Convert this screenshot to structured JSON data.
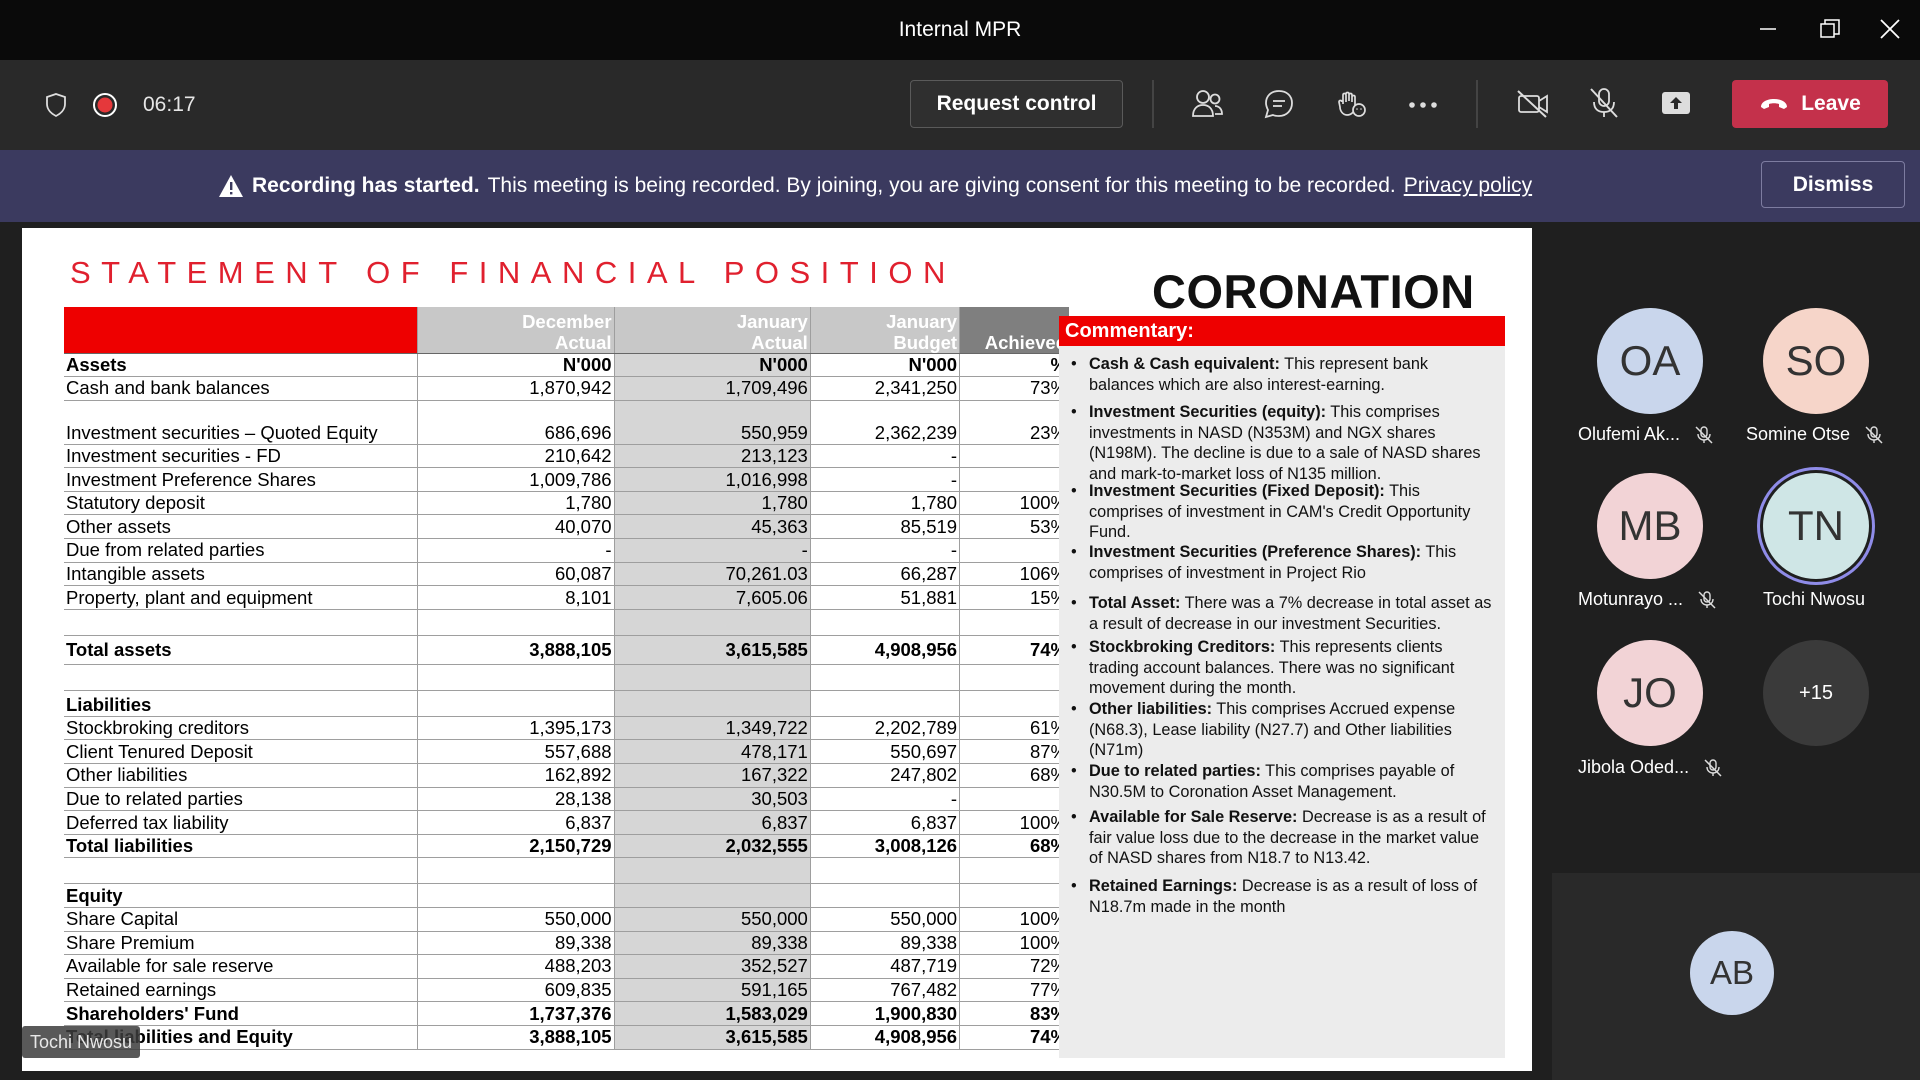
{
  "window": {
    "title": "Internal MPR"
  },
  "toolbar": {
    "timer": "06:17",
    "request_control": "Request control",
    "leave": "Leave"
  },
  "banner": {
    "bold": "Recording has started.",
    "text": "This meeting is being recorded. By joining, you are giving consent for this meeting to be recorded.",
    "link": "Privacy policy",
    "dismiss": "Dismiss"
  },
  "slide": {
    "title": "STATEMENT OF FINANCIAL POSITION",
    "logo": "CORONATION",
    "headers": {
      "c1": [
        "December",
        "Actual"
      ],
      "c2": [
        "January",
        "Actual"
      ],
      "c3": [
        "January",
        "Budget"
      ],
      "c4": "Achieved"
    },
    "rows": [
      {
        "label": "Assets",
        "v": [
          "N'000",
          "N'000",
          "N'000",
          "%"
        ],
        "style": "bold"
      },
      {
        "label": "Cash and bank balances",
        "v": [
          "1,870,942",
          "1,709,496",
          "2,341,250",
          "73%"
        ]
      },
      {
        "label": "Investment securities – Quoted Equity",
        "v": [
          "686,696",
          "550,959",
          "2,362,239",
          "23%"
        ],
        "style": "tall"
      },
      {
        "label": "Investment securities - FD",
        "v": [
          "210,642",
          "213,123",
          "-",
          "-"
        ]
      },
      {
        "label": "Investment Preference Shares",
        "v": [
          "1,009,786",
          "1,016,998",
          "-",
          "-"
        ]
      },
      {
        "label": "Statutory deposit",
        "v": [
          "1,780",
          "1,780",
          "1,780",
          "100%"
        ]
      },
      {
        "label": "Other assets",
        "v": [
          "40,070",
          "45,363",
          "85,519",
          "53%"
        ]
      },
      {
        "label": "Due from related parties",
        "v": [
          "-",
          "-",
          "-",
          "-"
        ]
      },
      {
        "label": "Intangible assets",
        "v": [
          "60,087",
          "70,261.03",
          "66,287",
          "106%"
        ]
      },
      {
        "label": "Property, plant and equipment",
        "v": [
          "8,101",
          "7,605.06",
          "51,881",
          "15%"
        ]
      },
      {
        "label": "",
        "v": [
          "",
          "",
          "",
          ""
        ],
        "style": "gap"
      },
      {
        "label": "Total assets",
        "v": [
          "3,888,105",
          "3,615,585",
          "4,908,956",
          "74%"
        ],
        "style": "bold mid"
      },
      {
        "label": "",
        "v": [
          "",
          "",
          "",
          ""
        ],
        "style": "gap"
      },
      {
        "label": "Liabilities",
        "v": [
          "",
          "",
          "",
          ""
        ],
        "style": "bold sec"
      },
      {
        "label": "Stockbroking creditors",
        "v": [
          "1,395,173",
          "1,349,722",
          "2,202,789",
          "61%"
        ]
      },
      {
        "label": "Client Tenured Deposit",
        "v": [
          "557,688",
          "478,171",
          "550,697",
          "87%"
        ]
      },
      {
        "label": "Other liabilities",
        "v": [
          "162,892",
          "167,322",
          "247,802",
          "68%"
        ]
      },
      {
        "label": "Due to related parties",
        "v": [
          "28,138",
          "30,503",
          "-",
          "-"
        ]
      },
      {
        "label": "Deferred tax liability",
        "v": [
          "6,837",
          "6,837",
          "6,837",
          "100%"
        ]
      },
      {
        "label": "Total liabilities",
        "v": [
          "2,150,729",
          "2,032,555",
          "3,008,126",
          "68%"
        ],
        "style": "bold"
      },
      {
        "label": "",
        "v": [
          "",
          "",
          "",
          ""
        ],
        "style": "gap"
      },
      {
        "label": "Equity",
        "v": [
          "",
          "",
          "",
          ""
        ],
        "style": "bold"
      },
      {
        "label": "Share Capital",
        "v": [
          "550,000",
          "550,000",
          "550,000",
          "100%"
        ]
      },
      {
        "label": "Share Premium",
        "v": [
          "89,338",
          "89,338",
          "89,338",
          "100%"
        ]
      },
      {
        "label": "Available for sale reserve",
        "v": [
          "488,203",
          "352,527",
          "487,719",
          "72%"
        ]
      },
      {
        "label": "Retained earnings",
        "v": [
          "609,835",
          "591,165",
          "767,482",
          "77%"
        ]
      },
      {
        "label": "Shareholders' Fund",
        "v": [
          "1,737,376",
          "1,583,029",
          "1,900,830",
          "83%"
        ],
        "style": "bold"
      },
      {
        "label": "Total liabilities and Equity",
        "v": [
          "3,888,105",
          "3,615,585",
          "4,908,956",
          "74%"
        ],
        "style": "bold"
      }
    ],
    "commentary_title": "Commentary:",
    "commentary": [
      {
        "head": "Cash & Cash equivalent:",
        "text": " This represent bank balances which are also interest-earning."
      },
      {
        "head": "Investment Securities (equity):",
        "text": " This comprises investments in NASD (N353M) and NGX shares (N198M). The decline is due to a sale of NASD shares and mark-to-market loss of N135 million."
      },
      {
        "head": "Investment Securities (Fixed Deposit):",
        "text": " This comprises of investment in CAM's Credit Opportunity Fund."
      },
      {
        "head": "Investment Securities (Preference Shares):",
        "text": " This comprises of investment in Project Rio"
      },
      {
        "head": "Total Asset:",
        "text": " There was a 7%  decrease in total asset as a result of  decrease in our investment Securities."
      },
      {
        "head": "Stockbroking Creditors:",
        "text": " This represents clients trading account balances. There was no significant movement during the month."
      },
      {
        "head": "Other liabilities:",
        "text": " This comprises Accrued expense (N68.3), Lease liability (N27.7) and Other liabilities (N71m)"
      },
      {
        "head": "Due to related parties:",
        "text": " This comprises payable of N30.5M to Coronation Asset Management."
      },
      {
        "head": "Available for Sale Reserve:",
        "text": " Decrease is as a result of fair value loss due to the decrease in the market value of NASD shares from N18.7 to N13.42."
      },
      {
        "head": "Retained Earnings:",
        "text": " Decrease is as a result of loss of N18.7m made in the month"
      }
    ]
  },
  "presenter_tag": "Tochi Nwosu",
  "participants": [
    {
      "initials": "OA",
      "name": "Olufemi Ak...",
      "muted": true,
      "color": "#c9d6ec"
    },
    {
      "initials": "SO",
      "name": "Somine Otse",
      "muted": true,
      "color": "#f6d5c9"
    },
    {
      "initials": "MB",
      "name": "Motunrayo ...",
      "muted": true,
      "color": "#f2d3d6"
    },
    {
      "initials": "TN",
      "name": "Tochi Nwosu",
      "muted": false,
      "color": "#cfe6e6"
    },
    {
      "initials": "JO",
      "name": "Jibola Oded...",
      "muted": true,
      "color": "#f2d3d6"
    },
    {
      "initials": "+15",
      "name": "",
      "muted": false,
      "color": "#3a3a3a"
    }
  ],
  "self_tile": {
    "initials": "AB",
    "color": "#c9d6ec"
  },
  "colors": {
    "accent_red": "#c4314b",
    "banner": "#3b3a5f",
    "slide_red": "#ee0000"
  }
}
